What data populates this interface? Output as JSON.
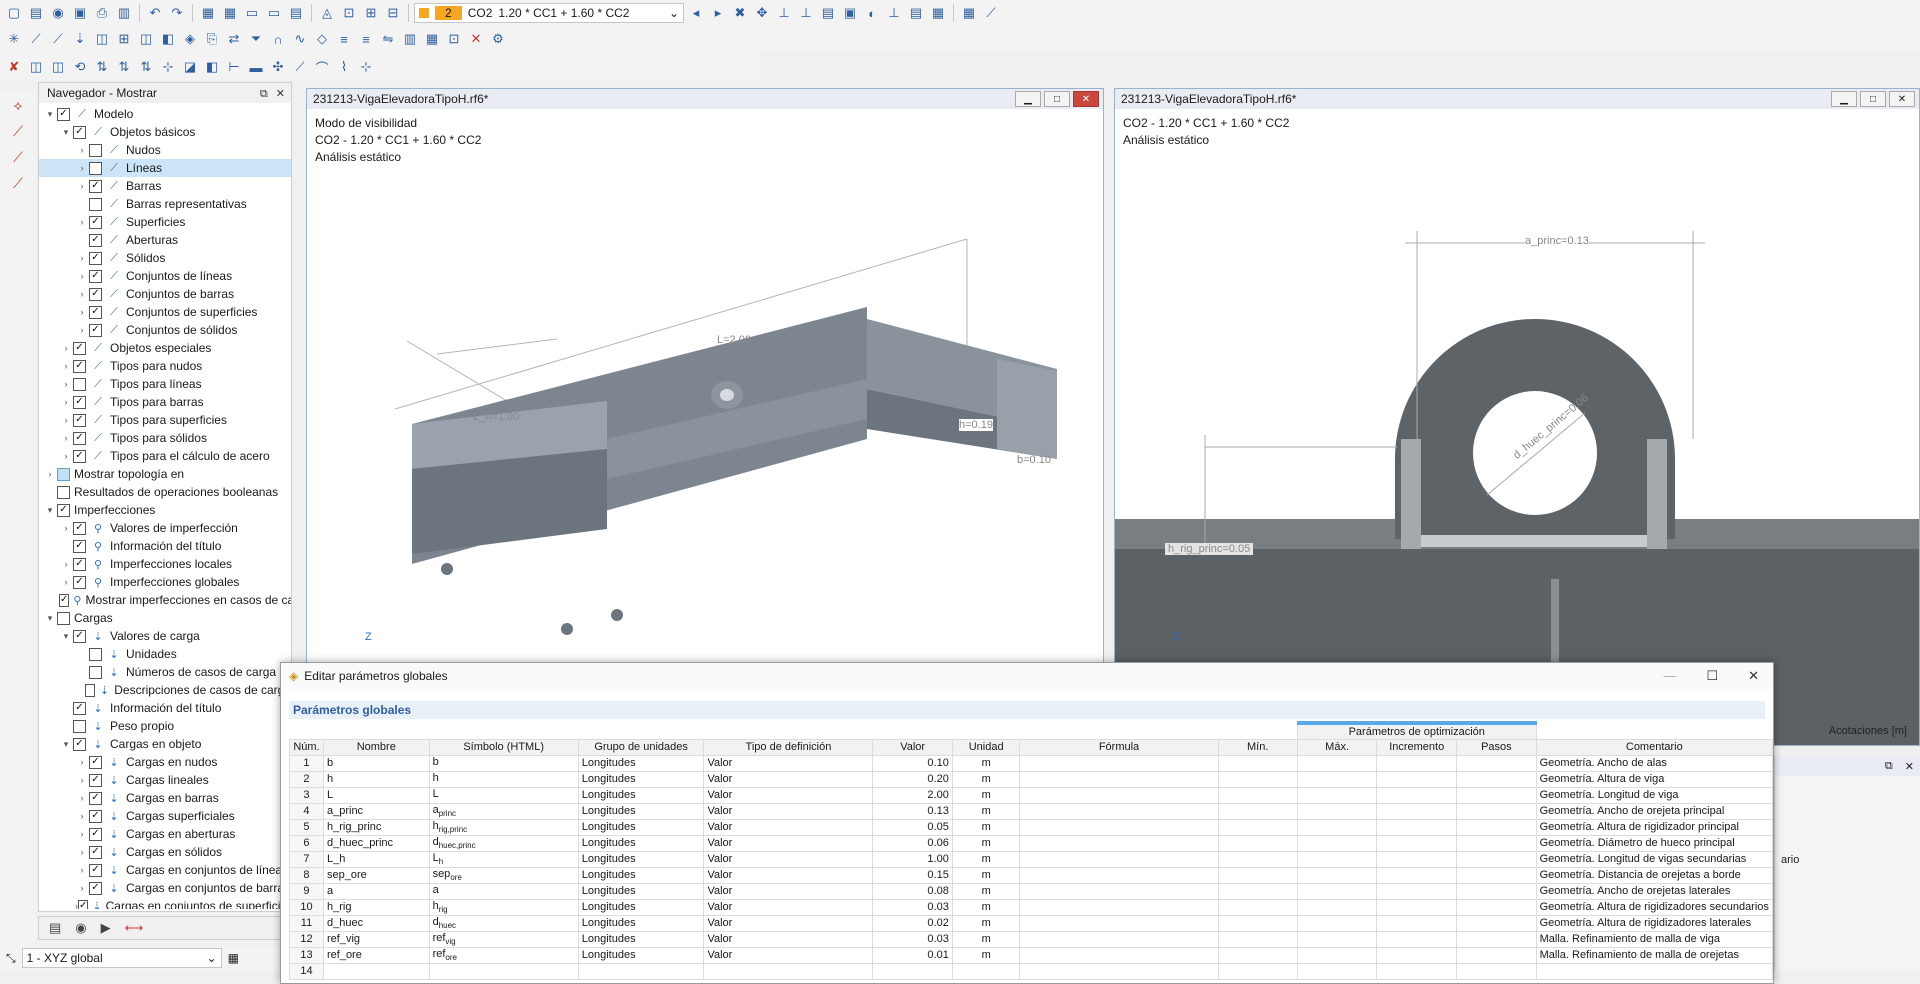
{
  "toolbar": {
    "load_case_number": "2",
    "load_case_name": "CO2",
    "load_case_formula": "1.20 * CC1 + 1.60 * CC2"
  },
  "navigator": {
    "title": "Navegador - Mostrar",
    "items": [
      {
        "label": "Modelo",
        "level": 0,
        "expand": "v",
        "check": "on",
        "icon": "model-icon"
      },
      {
        "label": "Objetos básicos",
        "level": 1,
        "expand": "v",
        "check": "on",
        "icon": "model-icon"
      },
      {
        "label": "Nudos",
        "level": 2,
        "expand": ">",
        "check": "off",
        "icon": "model-icon"
      },
      {
        "label": "Líneas",
        "level": 2,
        "expand": ">",
        "check": "off",
        "icon": "model-icon",
        "selected": true
      },
      {
        "label": "Barras",
        "level": 2,
        "expand": ">",
        "check": "on",
        "icon": "model-icon"
      },
      {
        "label": "Barras representativas",
        "level": 2,
        "expand": "",
        "check": "off",
        "icon": "model-icon"
      },
      {
        "label": "Superficies",
        "level": 2,
        "expand": ">",
        "check": "on",
        "icon": "model-icon"
      },
      {
        "label": "Aberturas",
        "level": 2,
        "expand": "",
        "check": "on",
        "icon": "model-icon"
      },
      {
        "label": "Sólidos",
        "level": 2,
        "expand": ">",
        "check": "on",
        "icon": "model-icon"
      },
      {
        "label": "Conjuntos de líneas",
        "level": 2,
        "expand": ">",
        "check": "on",
        "icon": "model-icon"
      },
      {
        "label": "Conjuntos de barras",
        "level": 2,
        "expand": ">",
        "check": "on",
        "icon": "model-icon"
      },
      {
        "label": "Conjuntos de superficies",
        "level": 2,
        "expand": ">",
        "check": "on",
        "icon": "model-icon"
      },
      {
        "label": "Conjuntos de sólidos",
        "level": 2,
        "expand": ">",
        "check": "on",
        "icon": "model-icon"
      },
      {
        "label": "Objetos especiales",
        "level": 1,
        "expand": ">",
        "check": "on",
        "icon": "model-icon"
      },
      {
        "label": "Tipos para nudos",
        "level": 1,
        "expand": ">",
        "check": "on",
        "icon": "model-icon"
      },
      {
        "label": "Tipos para líneas",
        "level": 1,
        "expand": ">",
        "check": "off",
        "icon": "model-icon"
      },
      {
        "label": "Tipos para barras",
        "level": 1,
        "expand": ">",
        "check": "on",
        "icon": "model-icon"
      },
      {
        "label": "Tipos para superficies",
        "level": 1,
        "expand": ">",
        "check": "on",
        "icon": "model-icon"
      },
      {
        "label": "Tipos para sólidos",
        "level": 1,
        "expand": ">",
        "check": "on",
        "icon": "model-icon"
      },
      {
        "label": "Tipos para el cálculo de acero",
        "level": 1,
        "expand": ">",
        "check": "on",
        "icon": "model-icon"
      },
      {
        "label": "Mostrar topología en",
        "level": 0,
        "expand": ">",
        "check": "half",
        "icon": "none"
      },
      {
        "label": "Resultados de operaciones booleanas",
        "level": 0,
        "expand": "",
        "check": "off",
        "icon": "none"
      },
      {
        "label": "Imperfecciones",
        "level": 0,
        "expand": "v",
        "check": "on",
        "icon": "none"
      },
      {
        "label": "Valores de imperfección",
        "level": 1,
        "expand": ">",
        "check": "on",
        "icon": "imperfection-icon"
      },
      {
        "label": "Información del título",
        "level": 1,
        "expand": "",
        "check": "on",
        "icon": "imperfection-icon"
      },
      {
        "label": "Imperfecciones locales",
        "level": 1,
        "expand": ">",
        "check": "on",
        "icon": "imperfection-icon"
      },
      {
        "label": "Imperfecciones globales",
        "level": 1,
        "expand": ">",
        "check": "on",
        "icon": "imperfection-icon"
      },
      {
        "label": "Mostrar imperfecciones en casos de carga",
        "level": 1,
        "expand": "",
        "check": "on",
        "icon": "imperfection-icon"
      },
      {
        "label": "Cargas",
        "level": 0,
        "expand": "v",
        "check": "off",
        "icon": "none"
      },
      {
        "label": "Valores de carga",
        "level": 1,
        "expand": "v",
        "check": "on",
        "icon": "load-icon"
      },
      {
        "label": "Unidades",
        "level": 2,
        "expand": "",
        "check": "off",
        "icon": "load-icon"
      },
      {
        "label": "Números de casos de carga",
        "level": 2,
        "expand": "",
        "check": "off",
        "icon": "load-icon"
      },
      {
        "label": "Descripciones de casos de carga",
        "level": 2,
        "expand": "",
        "check": "off",
        "icon": "load-icon"
      },
      {
        "label": "Información del título",
        "level": 1,
        "expand": "",
        "check": "on",
        "icon": "load-icon"
      },
      {
        "label": "Peso propio",
        "level": 1,
        "expand": "",
        "check": "off",
        "icon": "load-icon"
      },
      {
        "label": "Cargas en objeto",
        "level": 1,
        "expand": "v",
        "check": "on",
        "icon": "load-icon"
      },
      {
        "label": "Cargas en nudos",
        "level": 2,
        "expand": ">",
        "check": "on",
        "icon": "load-icon"
      },
      {
        "label": "Cargas lineales",
        "level": 2,
        "expand": ">",
        "check": "on",
        "icon": "load-icon"
      },
      {
        "label": "Cargas en barras",
        "level": 2,
        "expand": ">",
        "check": "on",
        "icon": "load-icon"
      },
      {
        "label": "Cargas superficiales",
        "level": 2,
        "expand": ">",
        "check": "on",
        "icon": "load-icon"
      },
      {
        "label": "Cargas en aberturas",
        "level": 2,
        "expand": ">",
        "check": "on",
        "icon": "load-icon"
      },
      {
        "label": "Cargas en sólidos",
        "level": 2,
        "expand": ">",
        "check": "on",
        "icon": "load-icon"
      },
      {
        "label": "Cargas en conjuntos de líneas",
        "level": 2,
        "expand": ">",
        "check": "on",
        "icon": "load-icon"
      },
      {
        "label": "Cargas en conjuntos de barras",
        "level": 2,
        "expand": ">",
        "check": "on",
        "icon": "load-icon"
      },
      {
        "label": "Cargas en conjuntos de superficies",
        "level": 2,
        "expand": ">",
        "check": "on",
        "icon": "load-icon"
      }
    ]
  },
  "status": {
    "coord_system": "1 - XYZ global"
  },
  "viewport_left": {
    "title": "231213-VigaElevadoraTipoH.rf6*",
    "line1": "Modo de visibilidad",
    "line2": "CO2 - 1.20 * CC1 + 1.60 * CC2",
    "line3": "Análisis estático",
    "dim_L": "L=2.00",
    "dim_Lh": "L_h=1.00",
    "dim_h": "h=0.19",
    "dim_b": "b=0.10",
    "axis_z": "Z"
  },
  "viewport_right": {
    "title": "231213-VigaElevadoraTipoH.rf6*",
    "line1": "CO2 - 1.20 * CC1 + 1.60 * CC2",
    "line2": "Análisis estático",
    "dim_a": "a_princ=0.13",
    "dim_d": "d_huec_princ=0.06",
    "dim_h": "h_rig_princ=0.05",
    "footer": "Acotaciones [m]",
    "axis_z": "Z"
  },
  "dialog": {
    "title": "Editar parámetros globales",
    "section": "Parámetros globales",
    "group_header": "Parámetros de optimización",
    "columns": [
      "Núm.",
      "Nombre",
      "Símbolo (HTML)",
      "Grupo de unidades",
      "Tipo de definición",
      "Valor",
      "Unidad",
      "Fórmula",
      "Mín.",
      "Máx.",
      "Incremento",
      "Pasos",
      "Comentario"
    ],
    "rows": [
      {
        "num": "1",
        "name": "b",
        "sym": "b",
        "sub": "",
        "group": "Longitudes",
        "type": "Valor",
        "value": "0.10",
        "unit": "m",
        "comment": "Geometría. Ancho de alas"
      },
      {
        "num": "2",
        "name": "h",
        "sym": "h",
        "sub": "",
        "group": "Longitudes",
        "type": "Valor",
        "value": "0.20",
        "unit": "m",
        "comment": "Geometría. Altura de viga"
      },
      {
        "num": "3",
        "name": "L",
        "sym": "L",
        "sub": "",
        "group": "Longitudes",
        "type": "Valor",
        "value": "2.00",
        "unit": "m",
        "comment": "Geometría. Longitud de viga"
      },
      {
        "num": "4",
        "name": "a_princ",
        "sym": "a",
        "sub": "princ",
        "group": "Longitudes",
        "type": "Valor",
        "value": "0.13",
        "unit": "m",
        "comment": "Geometría. Ancho de orejeta principal"
      },
      {
        "num": "5",
        "name": "h_rig_princ",
        "sym": "h",
        "sub": "rig,princ",
        "group": "Longitudes",
        "type": "Valor",
        "value": "0.05",
        "unit": "m",
        "comment": "Geometría. Altura de rigidizador principal"
      },
      {
        "num": "6",
        "name": "d_huec_princ",
        "sym": "d",
        "sub": "huec,princ",
        "group": "Longitudes",
        "type": "Valor",
        "value": "0.06",
        "unit": "m",
        "comment": "Geometría. Diámetro de hueco principal"
      },
      {
        "num": "7",
        "name": "L_h",
        "sym": "L",
        "sub": "h",
        "group": "Longitudes",
        "type": "Valor",
        "value": "1.00",
        "unit": "m",
        "comment": "Geometría. Longitud de vigas secundarias"
      },
      {
        "num": "8",
        "name": "sep_ore",
        "sym": "sep",
        "sub": "ore",
        "group": "Longitudes",
        "type": "Valor",
        "value": "0.15",
        "unit": "m",
        "comment": "Geometría. Distancia de orejetas a borde"
      },
      {
        "num": "9",
        "name": "a",
        "sym": "a",
        "sub": "",
        "group": "Longitudes",
        "type": "Valor",
        "value": "0.08",
        "unit": "m",
        "comment": "Geometría. Ancho de orejetas laterales"
      },
      {
        "num": "10",
        "name": "h_rig",
        "sym": "h",
        "sub": "rig",
        "group": "Longitudes",
        "type": "Valor",
        "value": "0.03",
        "unit": "m",
        "comment": "Geometría. Altura de rigidizadores secundarios"
      },
      {
        "num": "11",
        "name": "d_huec",
        "sym": "d",
        "sub": "huec",
        "group": "Longitudes",
        "type": "Valor",
        "value": "0.02",
        "unit": "m",
        "comment": "Geometría. Altura de rigidizadores laterales"
      },
      {
        "num": "12",
        "name": "ref_vig",
        "sym": "ref",
        "sub": "vig",
        "group": "Longitudes",
        "type": "Valor",
        "value": "0.03",
        "unit": "m",
        "comment": "Malla. Refinamiento de malla de viga"
      },
      {
        "num": "13",
        "name": "ref_ore",
        "sym": "ref",
        "sub": "ore",
        "group": "Longitudes",
        "type": "Valor",
        "value": "0.01",
        "unit": "m",
        "comment": "Malla. Refinamiento de malla de orejetas"
      },
      {
        "num": "14",
        "name": "",
        "sym": "",
        "sub": "",
        "group": "",
        "type": "",
        "value": "",
        "unit": "",
        "comment": ""
      }
    ]
  },
  "right_panel": {
    "partial_header": "ario"
  },
  "colors": {
    "accent": "#2f6fb5",
    "selection": "#cce4f7",
    "load_case": "#f5a623",
    "model_gray": "#7d8690"
  }
}
